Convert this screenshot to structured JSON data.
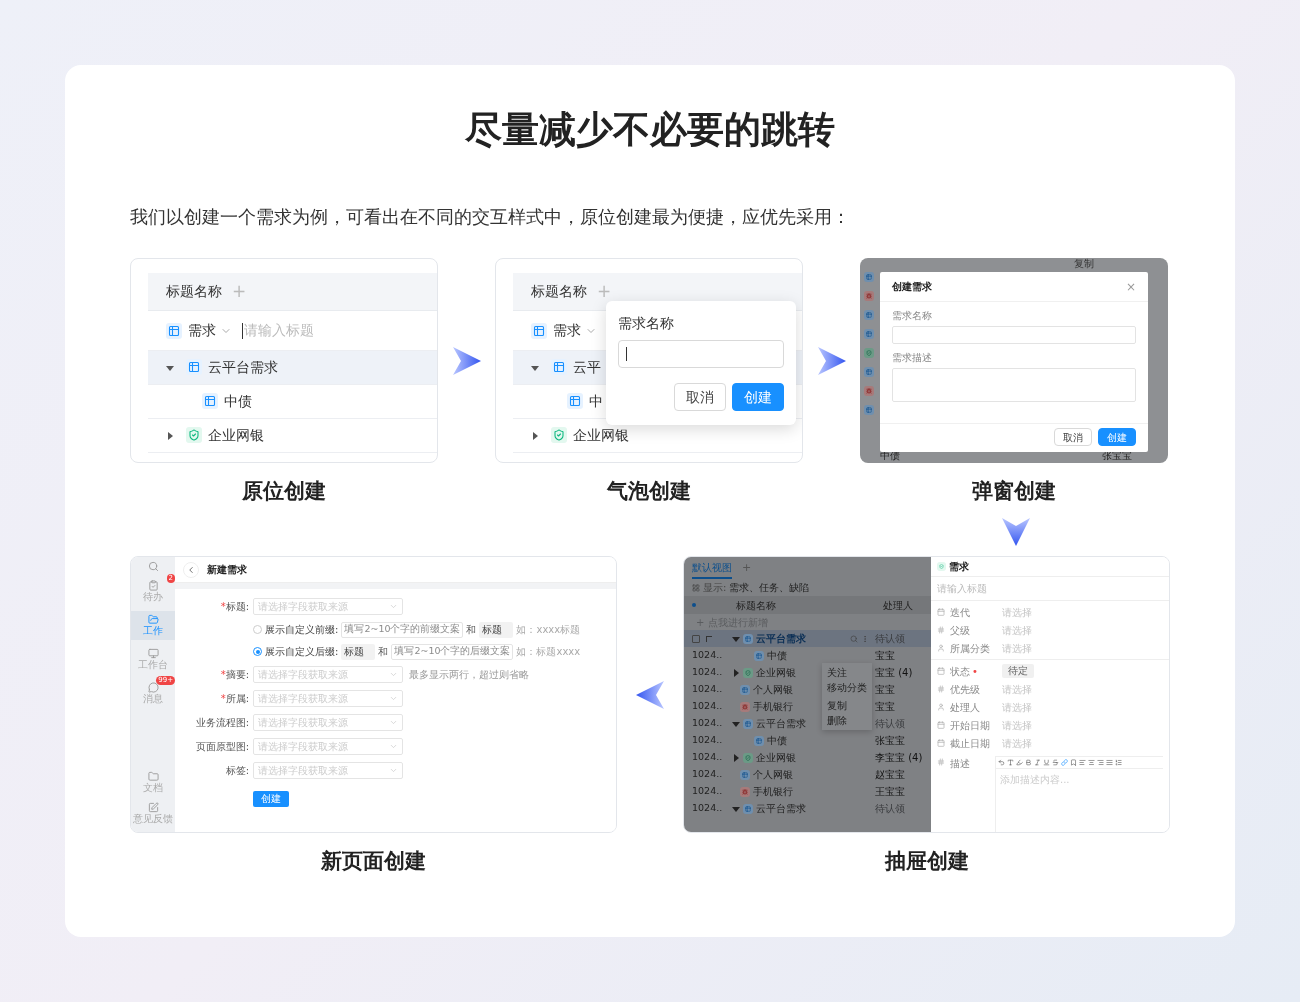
{
  "title": "尽量减少不必要的跳转",
  "intro": "我们以创建一个需求为例，可看出在不同的交互样式中，原位创建最为便捷，应优先采用：",
  "inplace": {
    "caption": "原位创建",
    "header": "标题名称",
    "add": "+",
    "type_select": "需求",
    "title_input": {
      "placeholder": "请输入标题",
      "focused": true
    },
    "rows": [
      {
        "name": "云平台需求",
        "kind": "requirement",
        "expanded": true,
        "selected": true,
        "children": [
          {
            "name": "中债",
            "kind": "requirement",
            "selected": false
          }
        ]
      },
      {
        "name": "企业网银",
        "kind": "feature",
        "expanded": false,
        "selected": false
      }
    ]
  },
  "bubble": {
    "caption": "气泡创建",
    "header": "标题名称",
    "add": "+",
    "type_select": "需求",
    "rows": [
      {
        "name": "云平",
        "kind": "requirement",
        "expanded": true,
        "selected": true,
        "children": [
          {
            "name": "中",
            "kind": "requirement",
            "selected": false
          }
        ]
      },
      {
        "name": "企业网银",
        "kind": "feature",
        "expanded": false,
        "selected": false
      }
    ],
    "popover": {
      "label": "需求名称",
      "field": {
        "focused": true
      },
      "buttons": [
        {
          "label": "取消",
          "primary": false
        },
        {
          "label": "创建",
          "primary": true
        }
      ]
    }
  },
  "dialog": {
    "caption": "弹窗创建",
    "backdrop": {
      "top_right": "复制",
      "bottom_left": "中债",
      "bottom_right": "张宝宝",
      "icons": [
        {
          "kind": "requirement"
        },
        {
          "kind": "defect"
        },
        {
          "kind": "requirement"
        },
        {
          "kind": "requirement"
        },
        {
          "kind": "feature"
        },
        {
          "kind": "requirement"
        },
        {
          "kind": "defect"
        },
        {
          "kind": "requirement"
        }
      ]
    },
    "title": "创建需求",
    "close": "×",
    "fields": [
      {
        "label": "需求名称",
        "kind": "input"
      },
      {
        "label": "需求描述",
        "kind": "textarea"
      }
    ],
    "buttons": [
      {
        "label": "取消",
        "primary": false
      },
      {
        "label": "创建",
        "primary": true
      }
    ]
  },
  "newpage": {
    "caption": "新页面创建",
    "sidebar": {
      "top": [
        {
          "label": "待办",
          "badge": "2",
          "selected": false
        },
        {
          "label": "工作",
          "selected": true
        },
        {
          "label": "工作台",
          "selected": false
        },
        {
          "label": "消息",
          "badge": "99+",
          "selected": false
        }
      ],
      "bottom": [
        {
          "label": "文档",
          "selected": false
        },
        {
          "label": "意见反馈",
          "selected": false
        }
      ]
    },
    "page_title": "新建需求",
    "form": [
      {
        "kind": "select",
        "required_mark": "*",
        "label": "标题:",
        "placeholder": "请选择字段获取来源"
      },
      {
        "kind": "affix",
        "label": "展示自定义前缀:",
        "selected": false,
        "parts": [
          {
            "kind": "input",
            "text": "填写2~10个字的前缀文案"
          },
          {
            "kind": "text",
            "text": "和"
          },
          {
            "kind": "fixed",
            "text": "标题"
          },
          {
            "kind": "hint",
            "text": "如：xxxx标题"
          }
        ]
      },
      {
        "kind": "affix",
        "label": "展示自定义后缀:",
        "selected": true,
        "parts": [
          {
            "kind": "fixed",
            "text": "标题"
          },
          {
            "kind": "text",
            "text": "和"
          },
          {
            "kind": "input",
            "text": "填写2~10个字的后缀文案"
          },
          {
            "kind": "hint",
            "text": "如：标题xxxx"
          }
        ]
      },
      {
        "kind": "select",
        "required_mark": "*",
        "label": "摘要:",
        "placeholder": "请选择字段获取来源",
        "hint": "最多显示两行，超过则省略"
      },
      {
        "kind": "select",
        "required_mark": "*",
        "label": "所属:",
        "placeholder": "请选择字段获取来源"
      },
      {
        "kind": "select",
        "label": "业务流程图:",
        "placeholder": "请选择字段获取来源"
      },
      {
        "kind": "select",
        "label": "页面原型图:",
        "placeholder": "请选择字段获取来源"
      },
      {
        "kind": "select",
        "label": "标签:",
        "placeholder": "请选择字段获取来源"
      }
    ],
    "submit": "创建"
  },
  "drawer": {
    "caption": "抽屉创建",
    "list": {
      "tabs": [
        {
          "label": "默认视图",
          "selected": true
        }
      ],
      "add_tab": "+",
      "filter_label": "显示:",
      "filter_value": "需求、任务、缺陷",
      "columns": [
        "标题名称",
        "处理人"
      ],
      "add_row": "+ 点我进行新增",
      "rows": [
        {
          "name": "云平台需求",
          "kind": "requirement",
          "expanded": true,
          "selected": true,
          "checked": false,
          "assignee": "待认领",
          "pending": true,
          "children": [
            {
              "id": "1024..",
              "name": "中债",
              "kind": "requirement",
              "selected": false,
              "assignee": "宝宝",
              "pending": false
            }
          ]
        },
        {
          "id": "1024..",
          "name": "企业网银",
          "kind": "feature",
          "expanded": false,
          "selected": false,
          "assignee": "宝宝 (4)",
          "pending": false
        },
        {
          "id": "1024..",
          "name": "个人网银",
          "kind": "requirement",
          "selected": false,
          "assignee": "宝宝",
          "pending": false
        },
        {
          "id": "1024..",
          "name": "手机银行",
          "kind": "defect",
          "selected": false,
          "assignee": "宝宝",
          "pending": false
        },
        {
          "id": "1024..",
          "name": "云平台需求",
          "kind": "requirement",
          "expanded": true,
          "selected": false,
          "assignee": "待认领",
          "pending": true,
          "children": [
            {
              "id": "1024..",
              "name": "中债",
              "kind": "requirement",
              "selected": false,
              "assignee": "张宝宝",
              "pending": false
            }
          ]
        },
        {
          "id": "1024..",
          "name": "企业网银",
          "kind": "feature",
          "expanded": false,
          "selected": false,
          "assignee": "李宝宝 (4)",
          "pending": false
        },
        {
          "id": "1024..",
          "name": "个人网银",
          "kind": "requirement",
          "selected": false,
          "assignee": "赵宝宝",
          "pending": false
        },
        {
          "id": "1024..",
          "name": "手机银行",
          "kind": "defect",
          "selected": false,
          "assignee": "王宝宝",
          "pending": false
        },
        {
          "id": "1024..",
          "name": "云平台需求",
          "kind": "requirement",
          "expanded": true,
          "selected": false,
          "assignee": "待认领",
          "pending": true
        }
      ],
      "menu": [
        "关注",
        "移动分类",
        "复制",
        "删除"
      ]
    },
    "panel": {
      "type_label": "需求",
      "title_placeholder": "请输入标题",
      "groups": [
        [
          {
            "label": "迭代",
            "placeholder": "请选择"
          },
          {
            "label": "父级",
            "placeholder": "请选择"
          },
          {
            "label": "所属分类",
            "placeholder": "请选择"
          }
        ],
        [
          {
            "label": "状态",
            "required_mark": "•",
            "value": "待定"
          },
          {
            "label": "优先级",
            "placeholder": "请选择"
          },
          {
            "label": "处理人",
            "placeholder": "请选择"
          },
          {
            "label": "开始日期",
            "placeholder": "请选择"
          },
          {
            "label": "截止日期",
            "placeholder": "请选择"
          }
        ]
      ],
      "description": {
        "label": "描述",
        "placeholder": "添加描述内容..."
      }
    }
  }
}
